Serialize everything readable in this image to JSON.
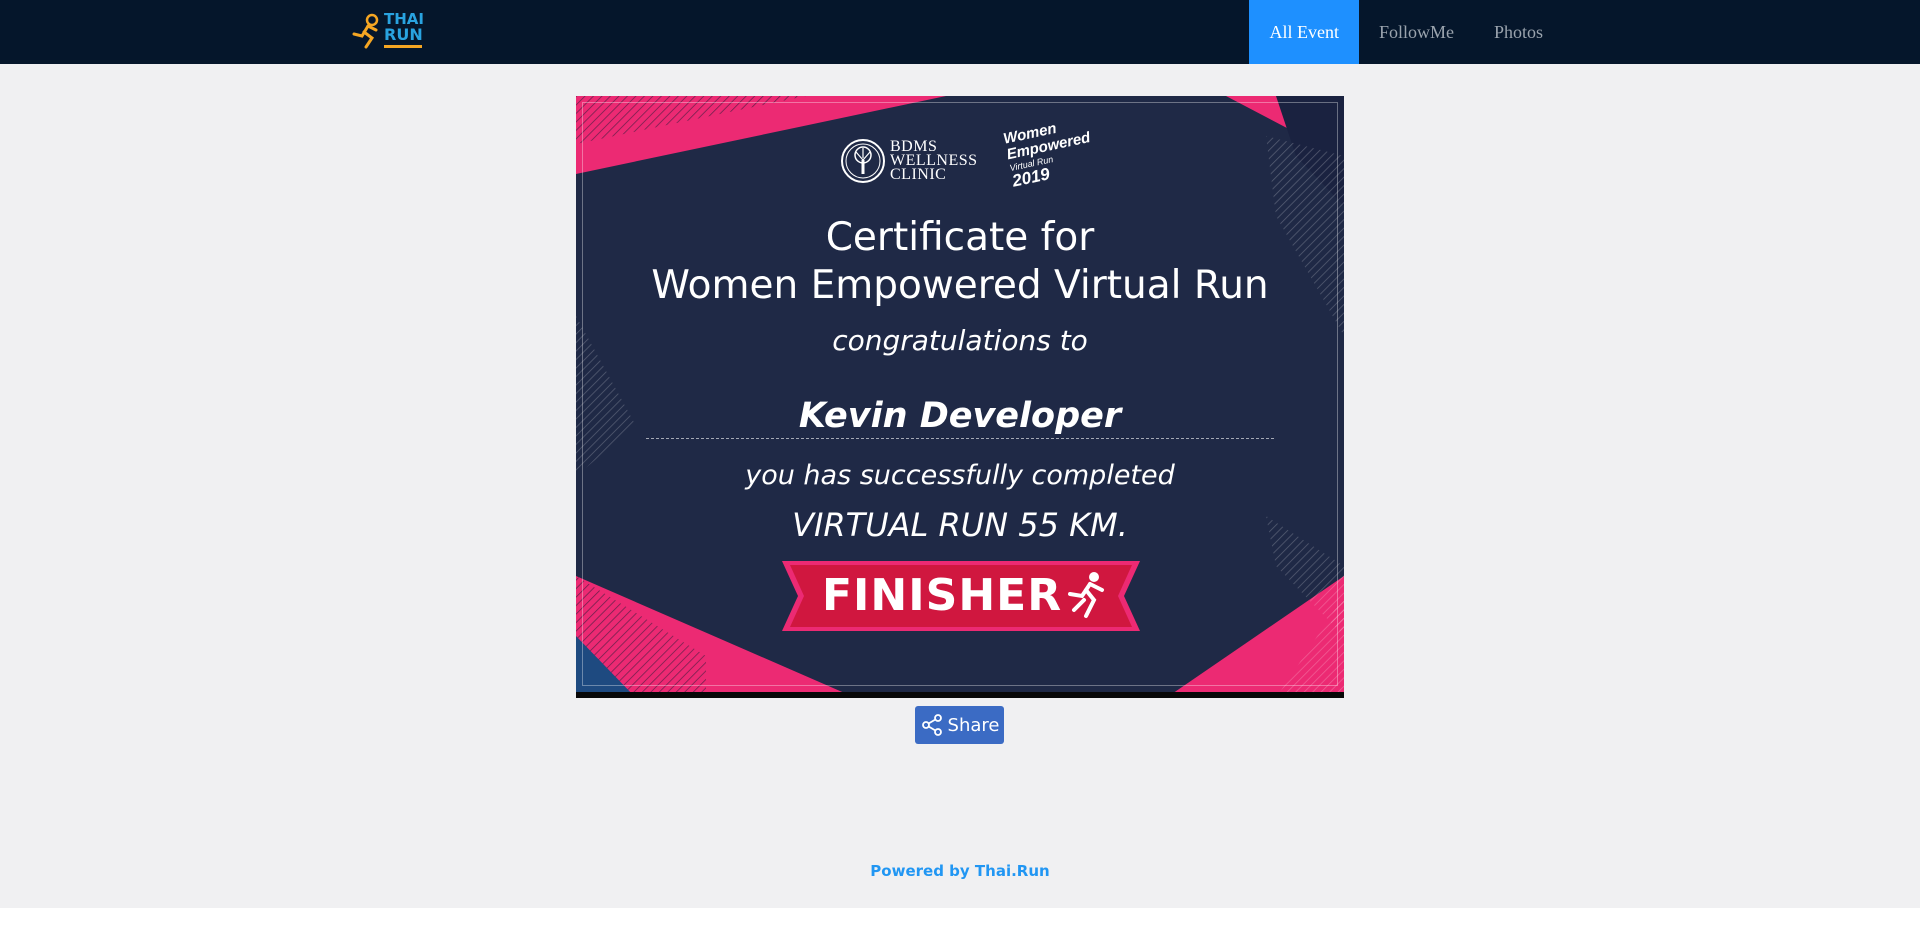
{
  "navbar": {
    "logo_line1": "THAI",
    "logo_line2": "RUN",
    "items": [
      {
        "label": "All Event",
        "active": true
      },
      {
        "label": "FollowMe",
        "active": false
      },
      {
        "label": "Photos",
        "active": false
      }
    ]
  },
  "certificate": {
    "sponsor_line1": "BDMS",
    "sponsor_line2": "WELLNESS",
    "sponsor_line3": "CLINIC",
    "event_logo_line1": "Women",
    "event_logo_line2": "Empowered",
    "event_logo_line3": "Virtual Run",
    "event_logo_line4": "2019",
    "title_line1": "Certificate for",
    "title_line2": "Women Empowered Virtual Run",
    "congrats": "congratulations to",
    "name": "Kevin Developer",
    "completed": "you has successfully completed",
    "distance": "VIRTUAL RUN 55 KM.",
    "badge": "FINISHER"
  },
  "share": {
    "label": "Share"
  },
  "footer": {
    "prefix": "Powered by",
    "link": "Thai.Run"
  },
  "colors": {
    "navbar_bg": "#05162b",
    "nav_active": "#1e90ff",
    "cert_bg": "#1f2946",
    "accent_pink": "#ec2a73",
    "badge_red": "#d0173f",
    "share_btn": "#3b6bc4",
    "footer_link": "#2196f3"
  }
}
